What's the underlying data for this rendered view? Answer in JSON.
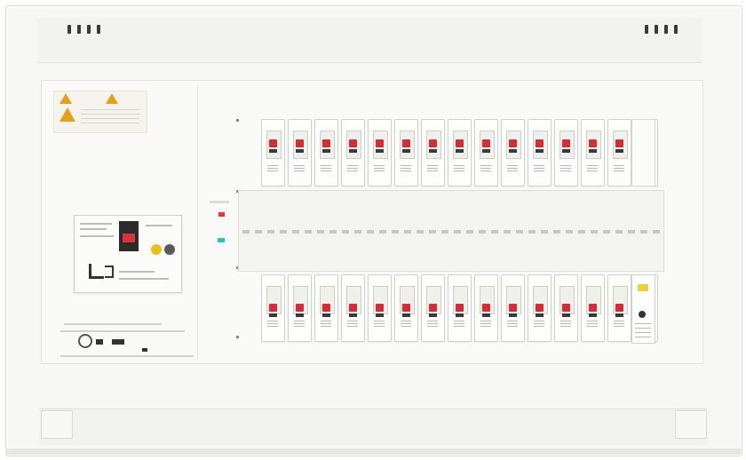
{
  "image": {
    "subject": "",
    "colors": {
      "enclosure": "#f6f6f4",
      "breaker_handle": "#d42d36",
      "main_breaker_window": "#2c2c2c",
      "warning_triangle": "#e5a118",
      "indicator_red": "#e53838",
      "indicator_cyan": "#29c5b9",
      "test_button": "#e8c21a"
    },
    "top_row_breaker_count": 15,
    "bottom_row_breaker_count": 15
  }
}
